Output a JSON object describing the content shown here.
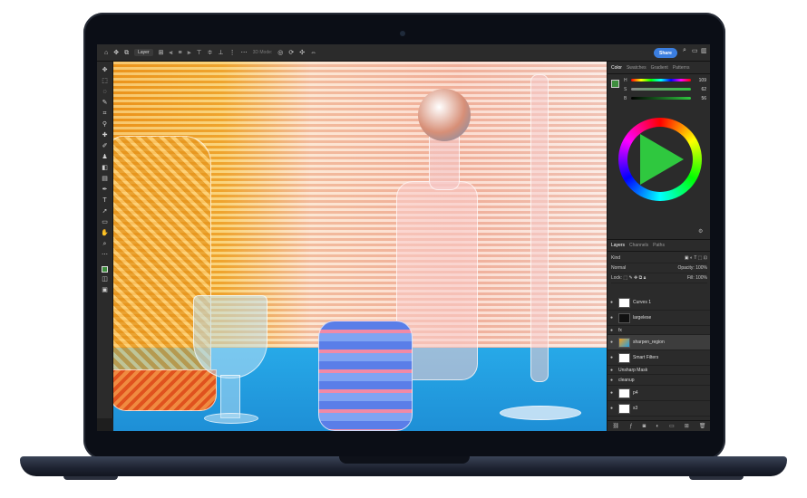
{
  "options_bar": {
    "layer_select": "Layer",
    "mode_3d": "3D Mode:",
    "share_label": "Share"
  },
  "color_panel": {
    "tabs": [
      "Color",
      "Swatches",
      "Gradient",
      "Patterns"
    ],
    "active_tab": "Color",
    "sliders": [
      {
        "label": "H",
        "value": "109"
      },
      {
        "label": "S",
        "value": "62"
      },
      {
        "label": "B",
        "value": "56"
      }
    ]
  },
  "layers_panel": {
    "tabs": [
      "Layers",
      "Channels",
      "Paths"
    ],
    "active_tab": "Layers",
    "kind_label": "Kind",
    "blend_mode": "Normal",
    "opacity_label": "Opacity:",
    "opacity_value": "100%",
    "lock_label": "Lock:",
    "fill_label": "Fill:",
    "fill_value": "100%",
    "layers": [
      {
        "name": "Curves 1"
      },
      {
        "name": "largelese"
      },
      {
        "name": "fx"
      },
      {
        "name": "sharpen_region"
      },
      {
        "name": "Smart Filters"
      },
      {
        "name": "Unsharp Mask"
      },
      {
        "name": "cleanup"
      },
      {
        "name": "p4"
      },
      {
        "name": "s3"
      }
    ]
  },
  "colors": {
    "accent": "#3b7ee0",
    "panel_bg": "#2b2b2b",
    "foreground_swatch": "#3f8f3f"
  }
}
